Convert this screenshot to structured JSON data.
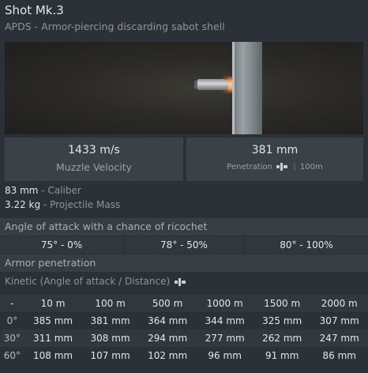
{
  "header": {
    "title": "Shot Mk.3",
    "subtitle": "APDS - Armor-piercing discarding sabot shell"
  },
  "stats": {
    "velocity_value": "1433 m/s",
    "velocity_label": "Muzzle Velocity",
    "penetration_value": "381 mm",
    "penetration_label": "Penetration",
    "penetration_sep": "|",
    "penetration_distance": "100m"
  },
  "specs": {
    "caliber_value": "83 mm",
    "caliber_label": "Caliber",
    "mass_value": "3.22 kg",
    "mass_label": "Projectile Mass",
    "dash": " - "
  },
  "ricochet": {
    "title": "Angle of attack with a chance of ricochet",
    "cells": [
      "75° - 0%",
      "78° - 50%",
      "80° - 100%"
    ]
  },
  "armor": {
    "title": "Armor penetration",
    "kinetic_label": "Kinetic (Angle of attack / Distance)",
    "columns": [
      "-",
      "10 m",
      "100 m",
      "500 m",
      "1000 m",
      "1500 m",
      "2000 m"
    ],
    "rows": [
      {
        "angle": "0°",
        "values": [
          "385 mm",
          "381 mm",
          "364 mm",
          "344 mm",
          "325 mm",
          "307 mm"
        ]
      },
      {
        "angle": "30°",
        "values": [
          "311 mm",
          "308 mm",
          "294 mm",
          "277 mm",
          "262 mm",
          "247 mm"
        ]
      },
      {
        "angle": "60°",
        "values": [
          "108 mm",
          "107 mm",
          "102 mm",
          "96 mm",
          "91 mm",
          "86 mm"
        ]
      }
    ]
  },
  "icons": {
    "penetration": "penetration-icon",
    "kinetic": "penetration-icon"
  }
}
